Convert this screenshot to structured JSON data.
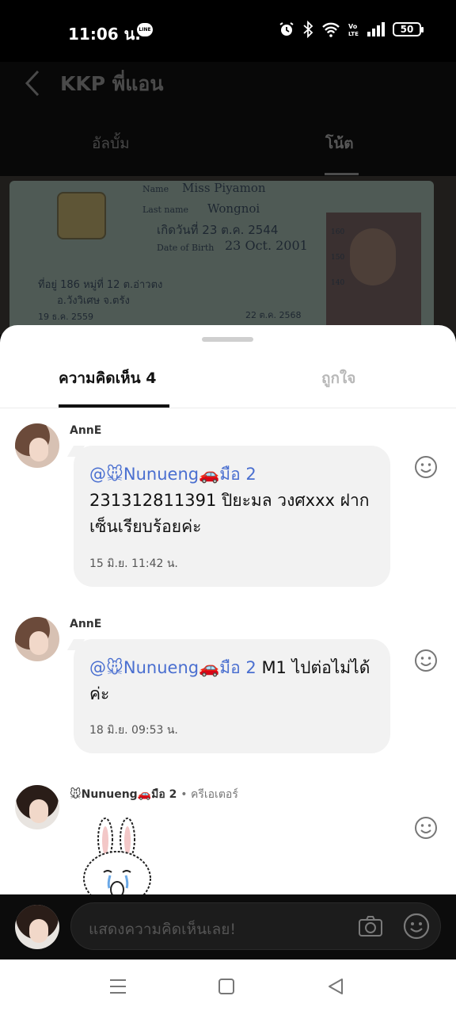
{
  "status_bar": {
    "time": "11:06 น.",
    "line_badge": "LINE",
    "battery": "50",
    "icons": [
      "line-icon",
      "alarm-icon",
      "bluetooth-icon",
      "wifi-icon",
      "volte-icon",
      "signal-icon",
      "battery-icon"
    ]
  },
  "header": {
    "title": "KKP พี่แอน",
    "tabs": [
      {
        "label": "อัลบั้ม"
      },
      {
        "label": "โน้ต"
      }
    ]
  },
  "photo": {
    "name_label": "Name",
    "name": "Miss Piyamon",
    "lastname_label": "Last name",
    "lastname": "Wongnoi",
    "dob_th": "เกิดวันที่  23 ต.ค. 2544",
    "dob_label": "Date of Birth",
    "dob": "23 Oct. 2001",
    "address_1": "ที่อยู่ 186 หมู่ที่ 12 ต.อ่าวตง",
    "address_2": "อ.วังวิเศษ จ.ตรัง",
    "issue_date": "19 ธ.ค. 2559",
    "expiry_date": "22 ต.ค. 2568",
    "height_marks": [
      "160",
      "150",
      "140"
    ]
  },
  "sheet": {
    "tabs": [
      {
        "label": "ความคิดเห็น 4"
      },
      {
        "label": "ถูกใจ"
      }
    ],
    "comments": [
      {
        "author": "AnnE",
        "mention": "@🐭Nunueng🚗มือ 2",
        "text": "231312811391 ปิยะมล วงศxxx ฝากเซ็นเรียบร้อยค่ะ",
        "time": "15 มิ.ย. 11:42 น."
      },
      {
        "author": "AnnE",
        "mention": "@🐭Nunueng🚗มือ 2",
        "text": "M1 ไปต่อไม่ได้ค่ะ",
        "time": "18 มิ.ย. 09:53 น."
      },
      {
        "author": "🐭Nunueng🚗มือ 2",
        "role": "• ครีเอเตอร์",
        "sticker": "crying-bunny-sticker"
      }
    ]
  },
  "input": {
    "placeholder": "แสดงความคิดเห็นเลย!"
  }
}
